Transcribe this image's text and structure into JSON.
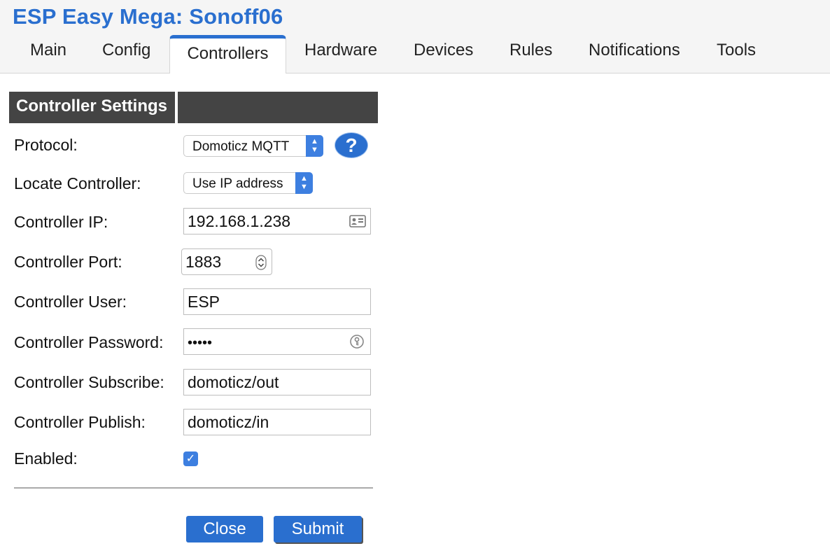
{
  "app": {
    "title": "ESP Easy Mega: Sonoff06"
  },
  "tabs": [
    {
      "label": "Main"
    },
    {
      "label": "Config"
    },
    {
      "label": "Controllers",
      "active": true
    },
    {
      "label": "Hardware"
    },
    {
      "label": "Devices"
    },
    {
      "label": "Rules"
    },
    {
      "label": "Notifications"
    },
    {
      "label": "Tools"
    }
  ],
  "section": {
    "title": "Controller Settings"
  },
  "form": {
    "protocol": {
      "label": "Protocol:",
      "value": "Domoticz MQTT"
    },
    "locate": {
      "label": "Locate Controller:",
      "value": "Use IP address"
    },
    "ip": {
      "label": "Controller IP:",
      "value": "192.168.1.238"
    },
    "port": {
      "label": "Controller Port:",
      "value": "1883"
    },
    "user": {
      "label": "Controller User:",
      "value": "ESP"
    },
    "password": {
      "label": "Controller Password:",
      "value": "•••••"
    },
    "subscribe": {
      "label": "Controller Subscribe:",
      "value": "domoticz/out"
    },
    "publish": {
      "label": "Controller Publish:",
      "value": "domoticz/in"
    },
    "enabled": {
      "label": "Enabled:",
      "checked": true
    }
  },
  "buttons": {
    "close": "Close",
    "submit": "Submit",
    "help": "?"
  },
  "colors": {
    "accent": "#2a6fcf",
    "section_bg": "#444444"
  }
}
